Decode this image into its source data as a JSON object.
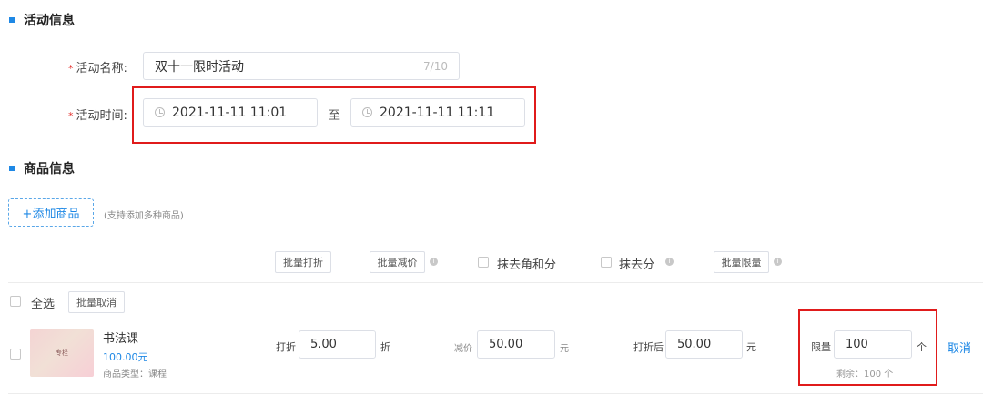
{
  "activity_section": {
    "title": "活动信息",
    "name_label": "活动名称:",
    "name_value": "双十一限时活动",
    "name_counter": "7/10",
    "time_label": "活动时间:",
    "required_mark": "*",
    "start_time": "2021-11-11 11:01",
    "to_label": "至",
    "end_time": "2021-11-11 11:11"
  },
  "product_section": {
    "title": "商品信息",
    "add_button": "+添加商品",
    "add_hint": "(支持添加多种商品)"
  },
  "batch_toolbar": {
    "batch_discount": "批量打折",
    "batch_reduce": "批量减价",
    "round_jiao_fen": "抹去角和分",
    "round_fen": "抹去分",
    "batch_limit": "批量限量"
  },
  "select_row": {
    "select_all": "全选",
    "batch_cancel": "批量取消"
  },
  "product": {
    "thumb_text": "专栏",
    "name": "书法课",
    "price": "100.00元",
    "type": "商品类型：课程",
    "discount_label": "打折",
    "discount_value": "5.00",
    "discount_unit": "折",
    "reduce_label": "减价",
    "reduce_value": "50.00",
    "reduce_unit": "元",
    "after_label": "打折后",
    "after_value": "50.00",
    "after_unit": "元",
    "limit_label": "限量",
    "limit_value": "100",
    "limit_unit": "个",
    "remaining": "剩余：100 个",
    "cancel": "取消"
  },
  "colors": {
    "accent": "#1e88e5",
    "highlight_box": "#e01b1b",
    "required": "#e53935"
  }
}
